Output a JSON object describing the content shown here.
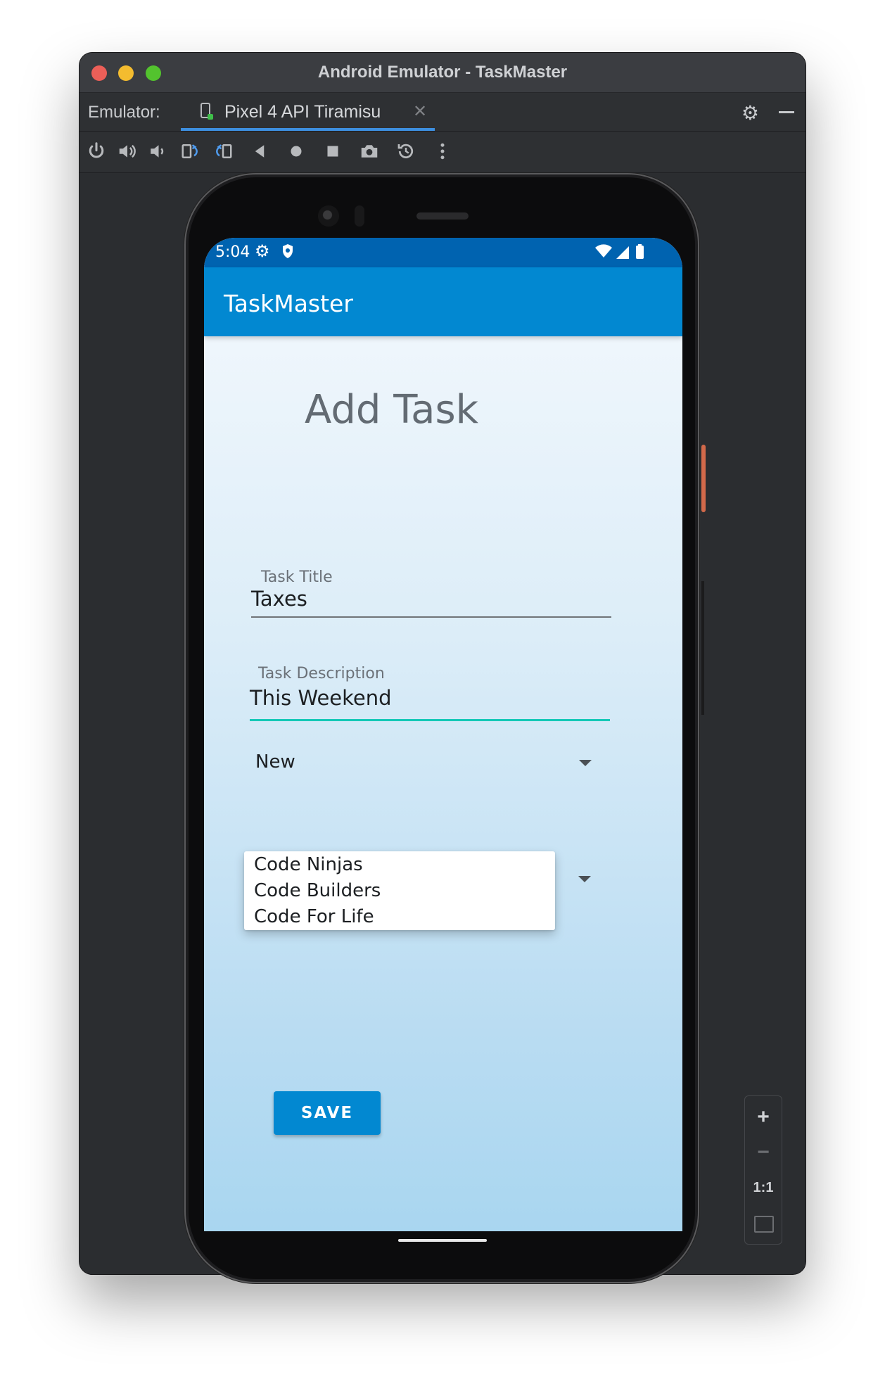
{
  "window": {
    "title": "Android Emulator - TaskMaster"
  },
  "tabbar": {
    "label": "Emulator:",
    "active_tab": "Pixel 4 API Tiramisu",
    "close_glyph": "✕"
  },
  "toolbar": {
    "icons": [
      "power-icon",
      "volume-up-icon",
      "volume-down-icon",
      "rotate-left-icon",
      "rotate-right-icon",
      "back-icon",
      "home-icon",
      "overview-icon",
      "camera-icon",
      "snapshot-icon",
      "more-icon"
    ]
  },
  "zoom": {
    "zoom_in": "+",
    "zoom_out": "−",
    "actual_size": "1:1"
  },
  "phone": {
    "status": {
      "time": "5:04"
    },
    "appbar": {
      "title": "TaskMaster"
    },
    "page": {
      "heading": "Add Task",
      "title_field": {
        "label": "Task Title",
        "value": "Taxes"
      },
      "description_field": {
        "label": "Task Description",
        "value": "This Weekend"
      },
      "state_spinner": {
        "selected": "New"
      },
      "team_dropdown": {
        "options": [
          "Code Ninjas",
          "Code Builders",
          "Code For Life"
        ]
      },
      "save_label": "SAVE"
    }
  },
  "colors": {
    "appbar": "#0288d1",
    "statusbar": "#0063b0",
    "accent_underline": "#15c8b6",
    "tab_indicator": "#3d8fe0"
  }
}
